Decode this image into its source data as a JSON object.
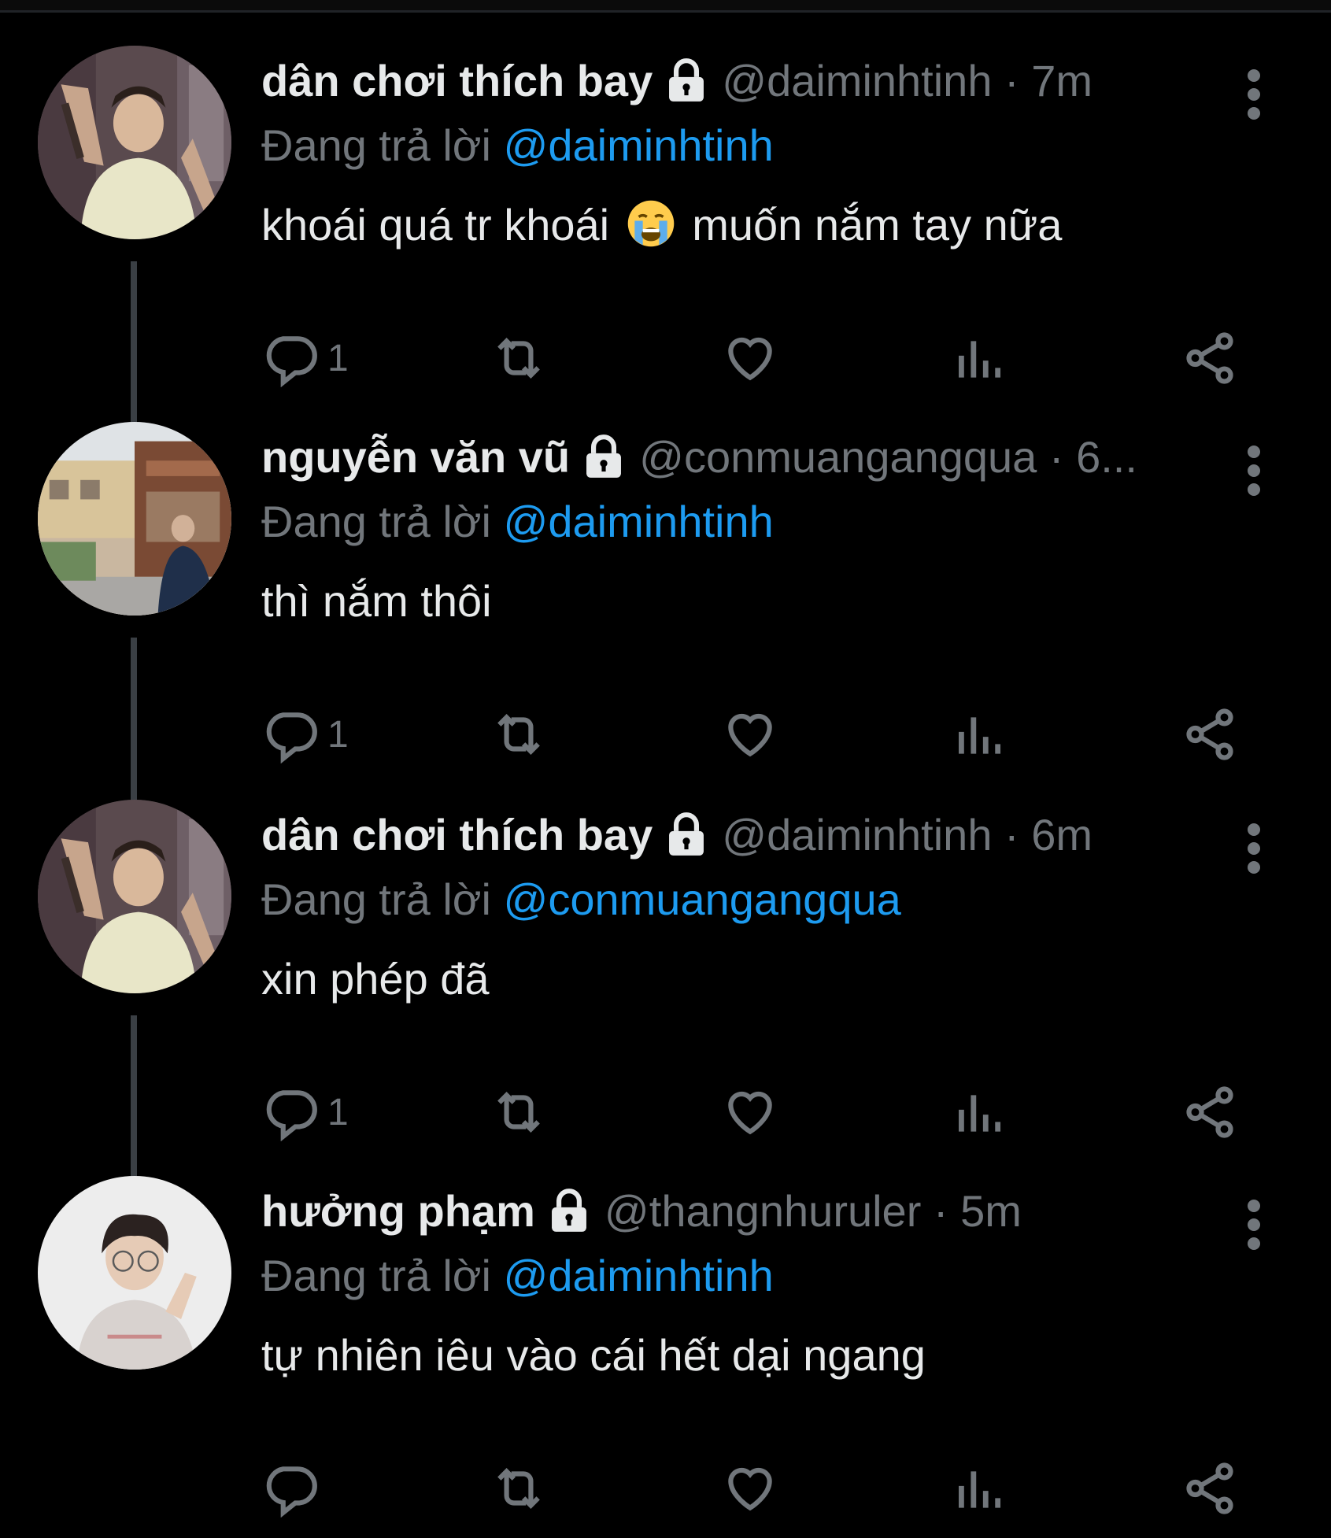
{
  "colors": {
    "background": "#000000",
    "primary_text": "#e7e9ea",
    "secondary_text": "#71767b",
    "link": "#1d9bf0",
    "thread_line": "#3a3f44"
  },
  "icons": {
    "lock": "lock-icon",
    "more": "more-vertical-icon",
    "reply": "reply-icon",
    "retweet": "retweet-icon",
    "like": "heart-icon",
    "views": "views-chart-icon",
    "share": "share-icon",
    "emoji": "loudly-crying-face-emoji"
  },
  "tweets": [
    {
      "display_name": "dân chơi thích bay",
      "handle_time": "@daiminhtinh · 7m",
      "reply_prefix": "Đang trả lời",
      "reply_to": "@daiminhtinh",
      "text_before": "khoái quá tr khoái",
      "text_after": "muốn nắm tay nữa",
      "reply_count": "1"
    },
    {
      "display_name": "nguyễn văn vũ",
      "handle_time": "@conmuangangqua · 6...",
      "reply_prefix": "Đang trả lời",
      "reply_to": "@daiminhtinh",
      "text": "thì nắm thôi",
      "reply_count": "1"
    },
    {
      "display_name": "dân chơi thích bay",
      "handle_time": "@daiminhtinh · 6m",
      "reply_prefix": "Đang trả lời",
      "reply_to": "@conmuangangqua",
      "text": "xin phép đã",
      "reply_count": "1"
    },
    {
      "display_name": "hưởng phạm",
      "handle_time": "@thangnhuruler · 5m",
      "reply_prefix": "Đang trả lời",
      "reply_to": "@daiminhtinh",
      "text": "tự nhiên iêu vào cái hết dại ngang",
      "reply_count": ""
    }
  ]
}
